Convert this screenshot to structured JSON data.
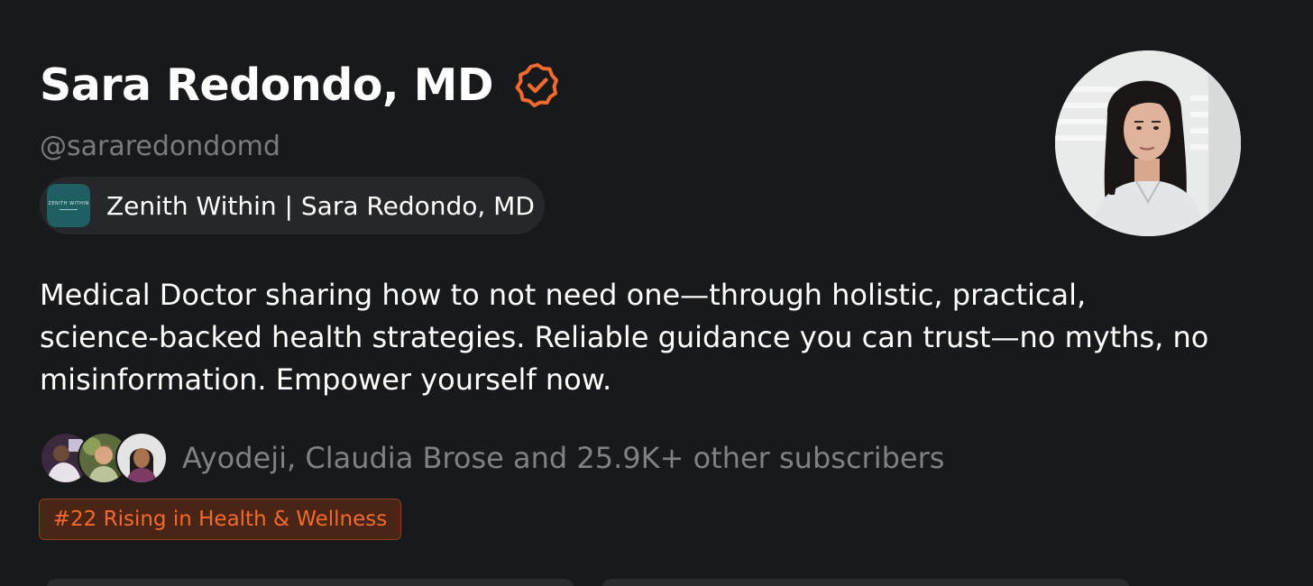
{
  "profile": {
    "name": "Sara Redondo, MD",
    "handle": "@sararedondomd",
    "verified_icon": "verified-badge-icon",
    "accent_color": "#f26a2e"
  },
  "publication": {
    "logo_text": "ZENITH WITHIN",
    "name": "Zenith Within | Sara Redondo, MD"
  },
  "bio": "Medical Doctor sharing how to not need one—through holistic, practical, science-backed health strategies. Reliable guidance you can trust—no myths, no misinformation. Empower yourself now.",
  "subscribers": {
    "text": "Ayodeji, Claudia Brose and 25.9K+ other subscribers",
    "avatars": [
      "subscriber-avatar-1",
      "subscriber-avatar-2",
      "subscriber-avatar-3"
    ]
  },
  "rank": {
    "label": "#22 Rising in Health & Wellness"
  }
}
